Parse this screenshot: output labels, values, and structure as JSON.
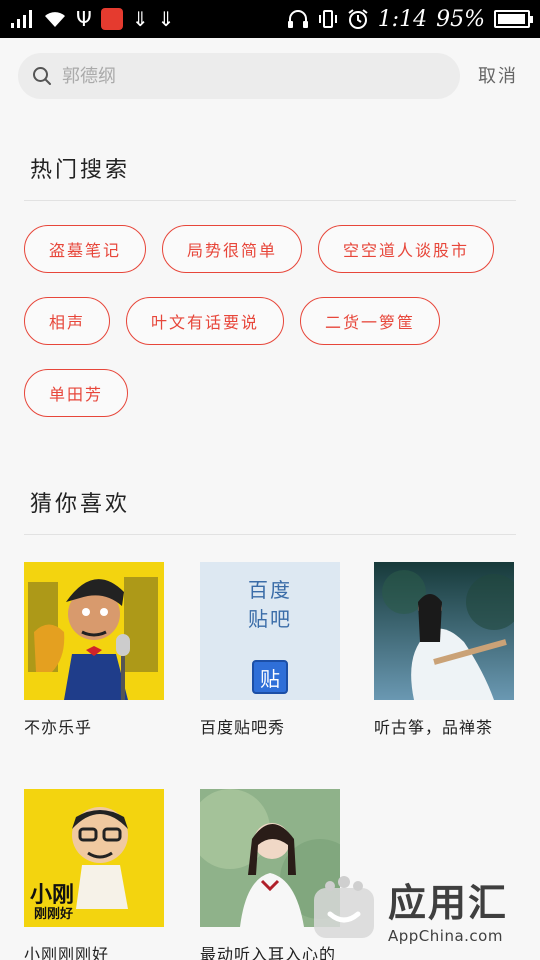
{
  "status_bar": {
    "time": "1:14",
    "battery_percent_text": "95%",
    "battery_level": 0.95,
    "icons": [
      "signal-icon",
      "wifi-icon",
      "usb-icon",
      "app-notification-icon",
      "download-icon",
      "download-icon",
      "headphones-icon",
      "vibrate-icon",
      "alarm-icon",
      "battery-icon"
    ]
  },
  "search": {
    "placeholder": "郭德纲",
    "value": "",
    "cancel_label": "取消"
  },
  "hot_search": {
    "title": "热门搜索",
    "tags": [
      [
        "盗墓笔记",
        "局势很简单",
        "空空道人谈股市"
      ],
      [
        "相声",
        "叶文有话要说",
        "二货一箩筐"
      ],
      [
        "单田芳"
      ]
    ]
  },
  "recommend": {
    "title": "猜你喜欢",
    "items": [
      {
        "title": "不亦乐乎",
        "thumb": "cartoon-man-microphone"
      },
      {
        "title": "百度贴吧秀",
        "thumb": "baidu-tieba-logo",
        "thumb_text_1": "百度",
        "thumb_text_2": "贴吧",
        "thumb_badge": "贴"
      },
      {
        "title": "听古筝，品禅茶",
        "thumb": "guzheng-player"
      },
      {
        "title": "小刚刚刚好",
        "thumb": "cartoon-xiaogang",
        "thumb_text": "小刚",
        "thumb_text_2": "刚刚好"
      },
      {
        "title": "最动听入耳入心的",
        "thumb": "girl-portrait"
      }
    ]
  },
  "watermark": {
    "main": "应用汇",
    "sub": "AppChina.com"
  },
  "colors": {
    "accent": "#e7463a",
    "status_bar": "#000000",
    "background": "#f7f7f7"
  }
}
